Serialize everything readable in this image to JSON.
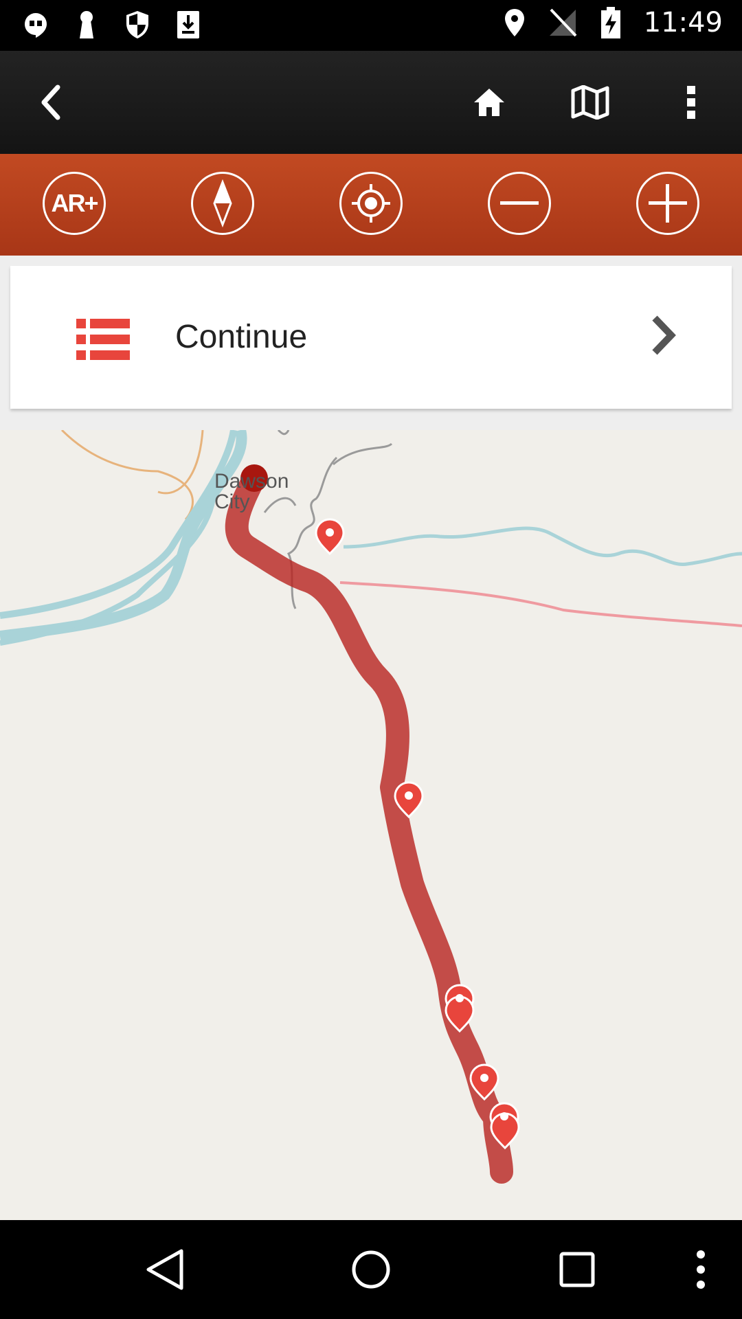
{
  "status_bar": {
    "time": "11:49",
    "left_icons": [
      "hangouts-icon",
      "keyhole-icon",
      "shield-icon",
      "download-icon"
    ],
    "right_icons": [
      "location-icon",
      "no-signal-icon",
      "battery-charging-icon"
    ]
  },
  "app_bar": {
    "actions": [
      "back-icon",
      "home-icon",
      "map-icon",
      "overflow-menu-icon"
    ]
  },
  "toolbar": {
    "ar_label": "AR+",
    "buttons": [
      "ar-button",
      "compass-button",
      "locate-button",
      "zoom-out-button",
      "zoom-in-button"
    ]
  },
  "card": {
    "label": "Continue",
    "icon": "list-icon",
    "accent": "#e8453c"
  },
  "map": {
    "city_label": "Dawson City",
    "route_color": "#b8231f",
    "marker_color": "#e8453c",
    "marker_count": 7
  },
  "nav_bar": {
    "buttons": [
      "back-triangle-icon",
      "home-circle-icon",
      "recents-square-icon",
      "more-icon"
    ]
  }
}
